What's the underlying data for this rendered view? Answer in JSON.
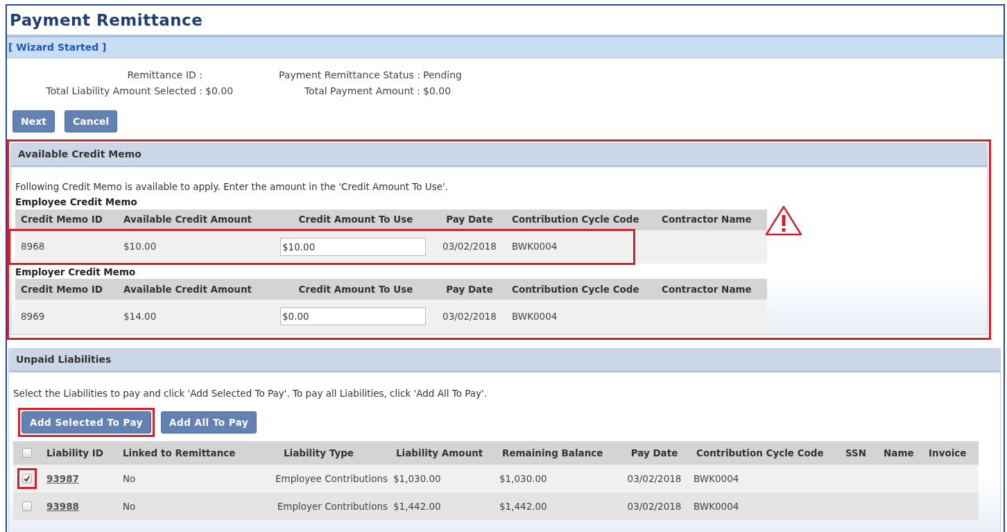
{
  "title": "Payment Remittance",
  "wizard_link": "[ Wizard Started ]",
  "summary": [
    {
      "label": "Remittance ID :"
    },
    {
      "label": "Payment Remittance Status :",
      "value": "Pending"
    },
    {
      "label": "Total Liability Amount Selected :",
      "value": "$0.00"
    },
    {
      "label": "Total Payment Amount :",
      "value": "$0.00"
    }
  ],
  "buttons": [
    "Next",
    "Cancel"
  ],
  "credit_memo": {
    "title": "Available Credit Memo",
    "highlighted": true,
    "warning": true,
    "instructions": "Following Credit Memo is available to apply. Enter the amount in the 'Credit Amount To Use'.",
    "groups": [
      {
        "title": "Employee Credit Memo",
        "columns": [
          "Credit Memo ID",
          "Available Credit Amount",
          "Credit Amount To Use",
          "Pay Date",
          "Contribution Cycle Code",
          "Contractor Name"
        ],
        "rows": [
          {
            "highlighted": true,
            "credit_memo_id": "8968",
            "available_credit_amount": "$10.00",
            "credit_amount_to_use": "$10.00",
            "pay_date": "03/02/2018",
            "contribution_cycle_code": "BWK0004"
          }
        ]
      },
      {
        "title": "Employer Credit Memo",
        "columns": [
          "Credit Memo ID",
          "Available Credit Amount",
          "Credit Amount To Use",
          "Pay Date",
          "Contribution Cycle Code",
          "Contractor Name"
        ],
        "rows": [
          {
            "highlighted": false,
            "credit_memo_id": "8969",
            "available_credit_amount": "$14.00",
            "credit_amount_to_use": "$0.00",
            "pay_date": "03/02/2018",
            "contribution_cycle_code": "BWK0004"
          }
        ]
      }
    ]
  },
  "liabilities": {
    "title": "Unpaid Liabilities",
    "instructions": "Select the Liabilities to pay and click 'Add Selected To Pay'. To pay all Liabilities, click 'Add All To Pay'.",
    "buttons": [
      {
        "label": "Add Selected To Pay",
        "highlighted": true
      },
      {
        "label": "Add All To Pay",
        "highlighted": false
      }
    ],
    "select_all_checked": false,
    "columns": [
      "Liability ID",
      "Linked to Remittance",
      "Liability Type",
      "Liability Amount",
      "Remaining Balance",
      "Pay Date",
      "Contribution Cycle Code",
      "SSN",
      "Name",
      "Invoice"
    ],
    "rows": [
      {
        "checked": true,
        "highlighted": true,
        "liability_id": "93987",
        "linked": "No",
        "type": "Employee Contributions",
        "amount": "$1,030.00",
        "remaining": "$1,030.00",
        "pay_date": "03/02/2018",
        "cycle_code": "BWK0004"
      },
      {
        "checked": false,
        "highlighted": false,
        "liability_id": "93988",
        "linked": "No",
        "type": "Employer Contributions",
        "amount": "$1,442.00",
        "remaining": "$1,442.00",
        "pay_date": "03/02/2018",
        "cycle_code": "BWK0004"
      }
    ]
  }
}
